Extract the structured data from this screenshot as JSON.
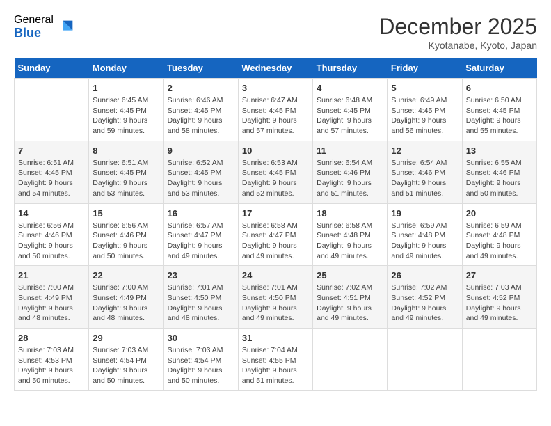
{
  "header": {
    "logo_general": "General",
    "logo_blue": "Blue",
    "month_title": "December 2025",
    "subtitle": "Kyotanabe, Kyoto, Japan"
  },
  "weekdays": [
    "Sunday",
    "Monday",
    "Tuesday",
    "Wednesday",
    "Thursday",
    "Friday",
    "Saturday"
  ],
  "weeks": [
    [
      {
        "day": "",
        "info": ""
      },
      {
        "day": "1",
        "info": "Sunrise: 6:45 AM\nSunset: 4:45 PM\nDaylight: 9 hours\nand 59 minutes."
      },
      {
        "day": "2",
        "info": "Sunrise: 6:46 AM\nSunset: 4:45 PM\nDaylight: 9 hours\nand 58 minutes."
      },
      {
        "day": "3",
        "info": "Sunrise: 6:47 AM\nSunset: 4:45 PM\nDaylight: 9 hours\nand 57 minutes."
      },
      {
        "day": "4",
        "info": "Sunrise: 6:48 AM\nSunset: 4:45 PM\nDaylight: 9 hours\nand 57 minutes."
      },
      {
        "day": "5",
        "info": "Sunrise: 6:49 AM\nSunset: 4:45 PM\nDaylight: 9 hours\nand 56 minutes."
      },
      {
        "day": "6",
        "info": "Sunrise: 6:50 AM\nSunset: 4:45 PM\nDaylight: 9 hours\nand 55 minutes."
      }
    ],
    [
      {
        "day": "7",
        "info": "Sunrise: 6:51 AM\nSunset: 4:45 PM\nDaylight: 9 hours\nand 54 minutes."
      },
      {
        "day": "8",
        "info": "Sunrise: 6:51 AM\nSunset: 4:45 PM\nDaylight: 9 hours\nand 53 minutes."
      },
      {
        "day": "9",
        "info": "Sunrise: 6:52 AM\nSunset: 4:45 PM\nDaylight: 9 hours\nand 53 minutes."
      },
      {
        "day": "10",
        "info": "Sunrise: 6:53 AM\nSunset: 4:45 PM\nDaylight: 9 hours\nand 52 minutes."
      },
      {
        "day": "11",
        "info": "Sunrise: 6:54 AM\nSunset: 4:46 PM\nDaylight: 9 hours\nand 51 minutes."
      },
      {
        "day": "12",
        "info": "Sunrise: 6:54 AM\nSunset: 4:46 PM\nDaylight: 9 hours\nand 51 minutes."
      },
      {
        "day": "13",
        "info": "Sunrise: 6:55 AM\nSunset: 4:46 PM\nDaylight: 9 hours\nand 50 minutes."
      }
    ],
    [
      {
        "day": "14",
        "info": "Sunrise: 6:56 AM\nSunset: 4:46 PM\nDaylight: 9 hours\nand 50 minutes."
      },
      {
        "day": "15",
        "info": "Sunrise: 6:56 AM\nSunset: 4:46 PM\nDaylight: 9 hours\nand 50 minutes."
      },
      {
        "day": "16",
        "info": "Sunrise: 6:57 AM\nSunset: 4:47 PM\nDaylight: 9 hours\nand 49 minutes."
      },
      {
        "day": "17",
        "info": "Sunrise: 6:58 AM\nSunset: 4:47 PM\nDaylight: 9 hours\nand 49 minutes."
      },
      {
        "day": "18",
        "info": "Sunrise: 6:58 AM\nSunset: 4:48 PM\nDaylight: 9 hours\nand 49 minutes."
      },
      {
        "day": "19",
        "info": "Sunrise: 6:59 AM\nSunset: 4:48 PM\nDaylight: 9 hours\nand 49 minutes."
      },
      {
        "day": "20",
        "info": "Sunrise: 6:59 AM\nSunset: 4:48 PM\nDaylight: 9 hours\nand 49 minutes."
      }
    ],
    [
      {
        "day": "21",
        "info": "Sunrise: 7:00 AM\nSunset: 4:49 PM\nDaylight: 9 hours\nand 48 minutes."
      },
      {
        "day": "22",
        "info": "Sunrise: 7:00 AM\nSunset: 4:49 PM\nDaylight: 9 hours\nand 48 minutes."
      },
      {
        "day": "23",
        "info": "Sunrise: 7:01 AM\nSunset: 4:50 PM\nDaylight: 9 hours\nand 48 minutes."
      },
      {
        "day": "24",
        "info": "Sunrise: 7:01 AM\nSunset: 4:50 PM\nDaylight: 9 hours\nand 49 minutes."
      },
      {
        "day": "25",
        "info": "Sunrise: 7:02 AM\nSunset: 4:51 PM\nDaylight: 9 hours\nand 49 minutes."
      },
      {
        "day": "26",
        "info": "Sunrise: 7:02 AM\nSunset: 4:52 PM\nDaylight: 9 hours\nand 49 minutes."
      },
      {
        "day": "27",
        "info": "Sunrise: 7:03 AM\nSunset: 4:52 PM\nDaylight: 9 hours\nand 49 minutes."
      }
    ],
    [
      {
        "day": "28",
        "info": "Sunrise: 7:03 AM\nSunset: 4:53 PM\nDaylight: 9 hours\nand 50 minutes."
      },
      {
        "day": "29",
        "info": "Sunrise: 7:03 AM\nSunset: 4:54 PM\nDaylight: 9 hours\nand 50 minutes."
      },
      {
        "day": "30",
        "info": "Sunrise: 7:03 AM\nSunset: 4:54 PM\nDaylight: 9 hours\nand 50 minutes."
      },
      {
        "day": "31",
        "info": "Sunrise: 7:04 AM\nSunset: 4:55 PM\nDaylight: 9 hours\nand 51 minutes."
      },
      {
        "day": "",
        "info": ""
      },
      {
        "day": "",
        "info": ""
      },
      {
        "day": "",
        "info": ""
      }
    ]
  ]
}
